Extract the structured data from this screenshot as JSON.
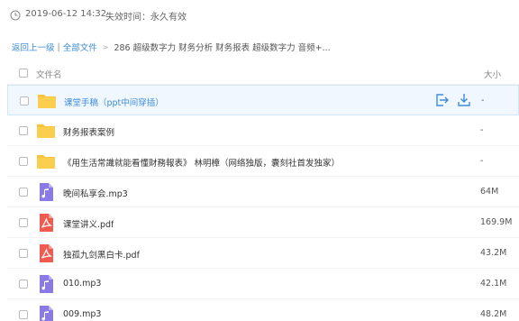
{
  "meta": {
    "date": "2019-06-12 14:32",
    "expire": "失效时间：永久有效"
  },
  "breadcrumb": {
    "back": "返回上一级",
    "separator": "|",
    "all_files": "全部文件",
    "arrow": ">",
    "current": "286 超级数字力 财务分析 财务报表 超级数字力 音频+..."
  },
  "list": {
    "header": {
      "name": "文件名",
      "size": "大小"
    },
    "rows": [
      {
        "name": "课堂手稿（ppt中间穿插）",
        "size": "-",
        "icon": "folder-icon"
      },
      {
        "name": "财务报表案例",
        "size": "-",
        "icon": "folder-icon"
      },
      {
        "name": "《用生活常識就能看懂財務報表》 林明樟（网络独版，囊刻社首发独家）",
        "size": "-",
        "icon": "folder-icon"
      },
      {
        "name": "晚间私享会.mp3",
        "size": "64M",
        "icon": "audio-file-icon"
      },
      {
        "name": "课堂讲义.pdf",
        "size": "169.9M",
        "icon": "pdf-file-icon"
      },
      {
        "name": "独孤九剑黑白卡.pdf",
        "size": "43.2M",
        "icon": "pdf-file-icon"
      },
      {
        "name": "010.mp3",
        "size": "42.1M",
        "icon": "audio-file-icon"
      },
      {
        "name": "009.mp3",
        "size": "48.2M",
        "icon": "audio-file-icon"
      }
    ]
  },
  "colors": {
    "link": "#3e8ed8",
    "folder": "#f7c23c",
    "audio": "#8a7ae6",
    "pdf": "#f05a50"
  }
}
